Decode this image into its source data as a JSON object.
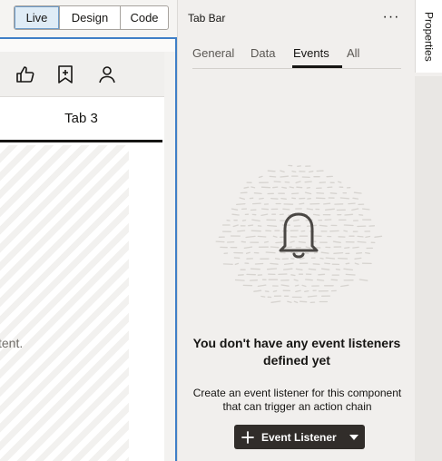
{
  "designer": {
    "modes": [
      {
        "label": "Live",
        "active": true
      },
      {
        "label": "Design",
        "active": false
      },
      {
        "label": "Code",
        "active": false
      }
    ],
    "toolbar_icons": [
      "thumbs-up-icon",
      "bookmark-add-icon",
      "user-icon"
    ],
    "tab_label": "Tab 3",
    "content_text": "tent."
  },
  "panel": {
    "title": "Tab Bar",
    "more_label": "···",
    "tabs": [
      {
        "label": "General",
        "active": false
      },
      {
        "label": "Data",
        "active": false
      },
      {
        "label": "Events",
        "active": true
      },
      {
        "label": "All",
        "active": false
      }
    ],
    "empty_state": {
      "icon": "bell-icon",
      "title": "You don't have any event listeners defined yet",
      "description": "Create an event listener for this component that can trigger an action chain",
      "button_label": "Event Listener"
    }
  },
  "rail": {
    "tab_label": "Properties"
  },
  "colors": {
    "accent_border": "#3f7fc7",
    "button_dark": "#312d2a",
    "active_mode_bg": "#dfecf6"
  }
}
